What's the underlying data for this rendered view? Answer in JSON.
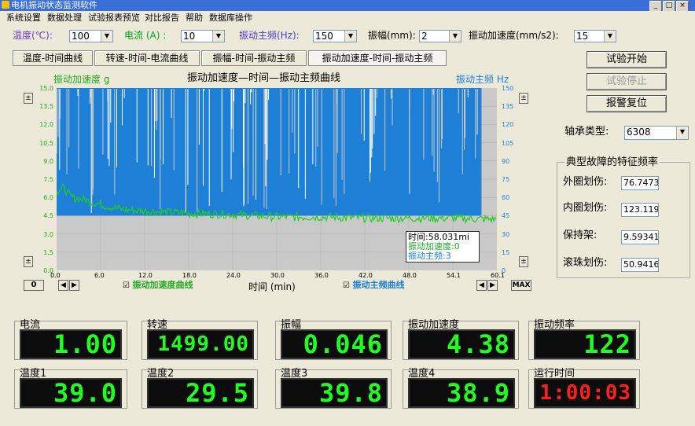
{
  "window": {
    "title": "电机振动状态监测软件"
  },
  "menu": [
    "系统设置",
    "数据处理",
    "试验报表预览",
    "对比报告",
    "帮助",
    "数据库操作"
  ],
  "params": [
    {
      "label": "温度(℃):",
      "value": "100",
      "color": "#6a3cc8"
    },
    {
      "label": "电流 (A) :",
      "value": "10",
      "color": "#00a020"
    },
    {
      "label": "振动主频(Hz):",
      "value": "150",
      "color": "#4a3cc8"
    },
    {
      "label": "振幅(mm):",
      "value": "2",
      "color": "#000000"
    },
    {
      "label": "振动加速度(mm/s2):",
      "value": "15",
      "color": "#000000"
    }
  ],
  "tabs": [
    "温度-时间曲线",
    "转速-时间-电流曲线",
    "振幅-时间-振动主频",
    "振动加速度-时间-振动主频"
  ],
  "chart": {
    "title": "振动加速度—时间—振动主频曲线",
    "left_label": "振动加速度 g",
    "right_label": "振动主频 Hz",
    "left_ticks": [
      "15.0",
      "13.5",
      "12.0",
      "10.5",
      "9.0",
      "7.5",
      "6.0",
      "4.5",
      "3.0",
      "1.5",
      "0.0"
    ],
    "right_ticks": [
      "150",
      "135",
      "120",
      "105",
      "90",
      "75",
      "60",
      "45",
      "30",
      "15",
      "0"
    ],
    "x_ticks": [
      "0.0",
      "6.0",
      "12.0",
      "18.0",
      "24.0",
      "30.0",
      "36.0",
      "42.0",
      "48.0",
      "54.1",
      "60.1"
    ],
    "xlabel": "时间 (min)",
    "legend_accel": "振动加速度曲线",
    "legend_freq": "振动主频曲线",
    "cursor_time": "时间:58.031mi",
    "cursor_accel": "振动加速度:0",
    "cursor_freq": "振动主频:3",
    "zero_btn": "0",
    "max_btn": "MAX",
    "accel_color": "#22cc22",
    "freq_color": "#1e7fd6"
  },
  "chart_data": {
    "type": "line",
    "title": "振动加速度—时间—振动主频曲线",
    "xlabel": "时间 (min)",
    "xlim": [
      0,
      60.1
    ],
    "series": [
      {
        "name": "振动加速度曲线",
        "axis": "left",
        "unit": "g",
        "ylim": [
          0,
          15
        ],
        "x": [
          0,
          1,
          2,
          4,
          6,
          9,
          12,
          15,
          18,
          24,
          30,
          36,
          42,
          48,
          54,
          60
        ],
        "values": [
          6.5,
          6.8,
          6.0,
          5.8,
          5.4,
          5.0,
          4.9,
          4.8,
          4.7,
          4.6,
          4.4,
          4.4,
          4.3,
          4.3,
          4.3,
          4.2
        ]
      },
      {
        "name": "振动主频曲线",
        "axis": "right",
        "unit": "Hz",
        "ylim": [
          0,
          150
        ],
        "x": [
          0,
          1,
          5,
          10,
          20,
          30,
          40,
          50,
          58,
          60
        ],
        "values": [
          150,
          150,
          150,
          150,
          150,
          150,
          150,
          150,
          150,
          150
        ]
      }
    ]
  },
  "controls": {
    "start": "试验开始",
    "stop": "试验停止",
    "reset": "报警复位",
    "bearing_label": "轴承类型:",
    "bearing_value": "6308",
    "fault_title": "典型故障的特征频率",
    "faults": [
      {
        "label": "外圈划伤:",
        "value": "76.7473"
      },
      {
        "label": "内圈划伤:",
        "value": "123.119"
      },
      {
        "label": "保持架:",
        "value": "9.59341"
      },
      {
        "label": "滚珠划伤:",
        "value": "50.9416"
      }
    ]
  },
  "readouts": [
    {
      "label": "电流",
      "value": "1.00",
      "color": "green"
    },
    {
      "label": "转速",
      "value": "1499.00",
      "color": "green"
    },
    {
      "label": "振幅",
      "value": "0.046",
      "color": "green"
    },
    {
      "label": "振动加速度",
      "value": "4.38",
      "color": "green"
    },
    {
      "label": "振动频率",
      "value": "122",
      "color": "green"
    },
    {
      "label": "温度1",
      "value": "39.0",
      "color": "green"
    },
    {
      "label": "温度2",
      "value": "29.5",
      "color": "green"
    },
    {
      "label": "温度3",
      "value": "39.8",
      "color": "green"
    },
    {
      "label": "温度4",
      "value": "38.9",
      "color": "green"
    },
    {
      "label": "运行时间",
      "value": "1:00:03",
      "color": "red"
    }
  ]
}
